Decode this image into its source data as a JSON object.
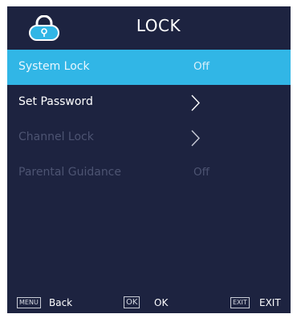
{
  "header": {
    "title": "LOCK",
    "icon": "lock-icon",
    "icon_color": "#31b6e6"
  },
  "menu": {
    "items": [
      {
        "label": "System Lock",
        "value": "Off",
        "state": "selected"
      },
      {
        "label": "Set Password",
        "value": "",
        "state": "enabled",
        "icon": "chevron-right-icon"
      },
      {
        "label": "Channel Lock",
        "value": "",
        "state": "disabled",
        "icon": "chevron-right-icon"
      },
      {
        "label": "Parental Guidance",
        "value": "Off",
        "state": "disabled"
      }
    ]
  },
  "footer": {
    "back_key": "MENU",
    "back_label": "Back",
    "ok_key": "OK",
    "ok_label": "OK",
    "exit_key": "EXIT",
    "exit_label": "EXIT"
  },
  "colors": {
    "background": "#1d2340",
    "accent": "#31b6e6",
    "disabled_text": "#4d5472"
  }
}
